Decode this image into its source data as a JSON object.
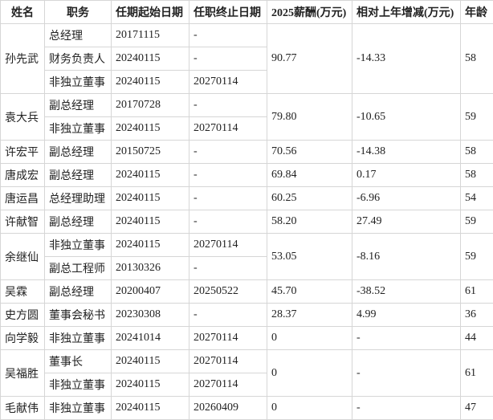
{
  "headers": [
    "姓名",
    "职务",
    "任期起始日期",
    "任职终止日期",
    "2025薪酬(万元)",
    "相对上年增减(万元)",
    "年龄"
  ],
  "people": [
    {
      "name": "孙先武",
      "roles": [
        {
          "title": "总经理",
          "start": "20171115",
          "end": "-"
        },
        {
          "title": "财务负责人",
          "start": "20240115",
          "end": "-"
        },
        {
          "title": "非独立董事",
          "start": "20240115",
          "end": "20270114"
        }
      ],
      "pay": "90.77",
      "change": "-14.33",
      "age": "58"
    },
    {
      "name": "袁大兵",
      "roles": [
        {
          "title": "副总经理",
          "start": "20170728",
          "end": "-"
        },
        {
          "title": "非独立董事",
          "start": "20240115",
          "end": "20270114"
        }
      ],
      "pay": "79.80",
      "change": "-10.65",
      "age": "59"
    },
    {
      "name": "许宏平",
      "roles": [
        {
          "title": "副总经理",
          "start": "20150725",
          "end": "-"
        }
      ],
      "pay": "70.56",
      "change": "-14.38",
      "age": "58"
    },
    {
      "name": "唐成宏",
      "roles": [
        {
          "title": "副总经理",
          "start": "20240115",
          "end": "-"
        }
      ],
      "pay": "69.84",
      "change": "0.17",
      "age": "58"
    },
    {
      "name": "唐运昌",
      "roles": [
        {
          "title": "总经理助理",
          "start": "20240115",
          "end": "-"
        }
      ],
      "pay": "60.25",
      "change": "-6.96",
      "age": "54"
    },
    {
      "name": "许献智",
      "roles": [
        {
          "title": "副总经理",
          "start": "20240115",
          "end": "-"
        }
      ],
      "pay": "58.20",
      "change": "27.49",
      "age": "59"
    },
    {
      "name": "余继仙",
      "roles": [
        {
          "title": "非独立董事",
          "start": "20240115",
          "end": "20270114"
        },
        {
          "title": "副总工程师",
          "start": "20130326",
          "end": "-"
        }
      ],
      "pay": "53.05",
      "change": "-8.16",
      "age": "59"
    },
    {
      "name": "吴霖",
      "roles": [
        {
          "title": "副总经理",
          "start": "20200407",
          "end": "20250522"
        }
      ],
      "pay": "45.70",
      "change": "-38.52",
      "age": "61"
    },
    {
      "name": "史方圆",
      "roles": [
        {
          "title": "董事会秘书",
          "start": "20230308",
          "end": "-"
        }
      ],
      "pay": "28.37",
      "change": "4.99",
      "age": "36"
    },
    {
      "name": "向学毅",
      "roles": [
        {
          "title": "非独立董事",
          "start": "20241014",
          "end": "20270114"
        }
      ],
      "pay": "0",
      "change": "-",
      "age": "44"
    },
    {
      "name": "吴福胜",
      "roles": [
        {
          "title": "董事长",
          "start": "20240115",
          "end": "20270114"
        },
        {
          "title": "非独立董事",
          "start": "20240115",
          "end": "20270114"
        }
      ],
      "pay": "0",
      "change": "-",
      "age": "61"
    },
    {
      "name": "毛献伟",
      "roles": [
        {
          "title": "非独立董事",
          "start": "20240115",
          "end": "20260409"
        }
      ],
      "pay": "0",
      "change": "-",
      "age": "47"
    }
  ]
}
